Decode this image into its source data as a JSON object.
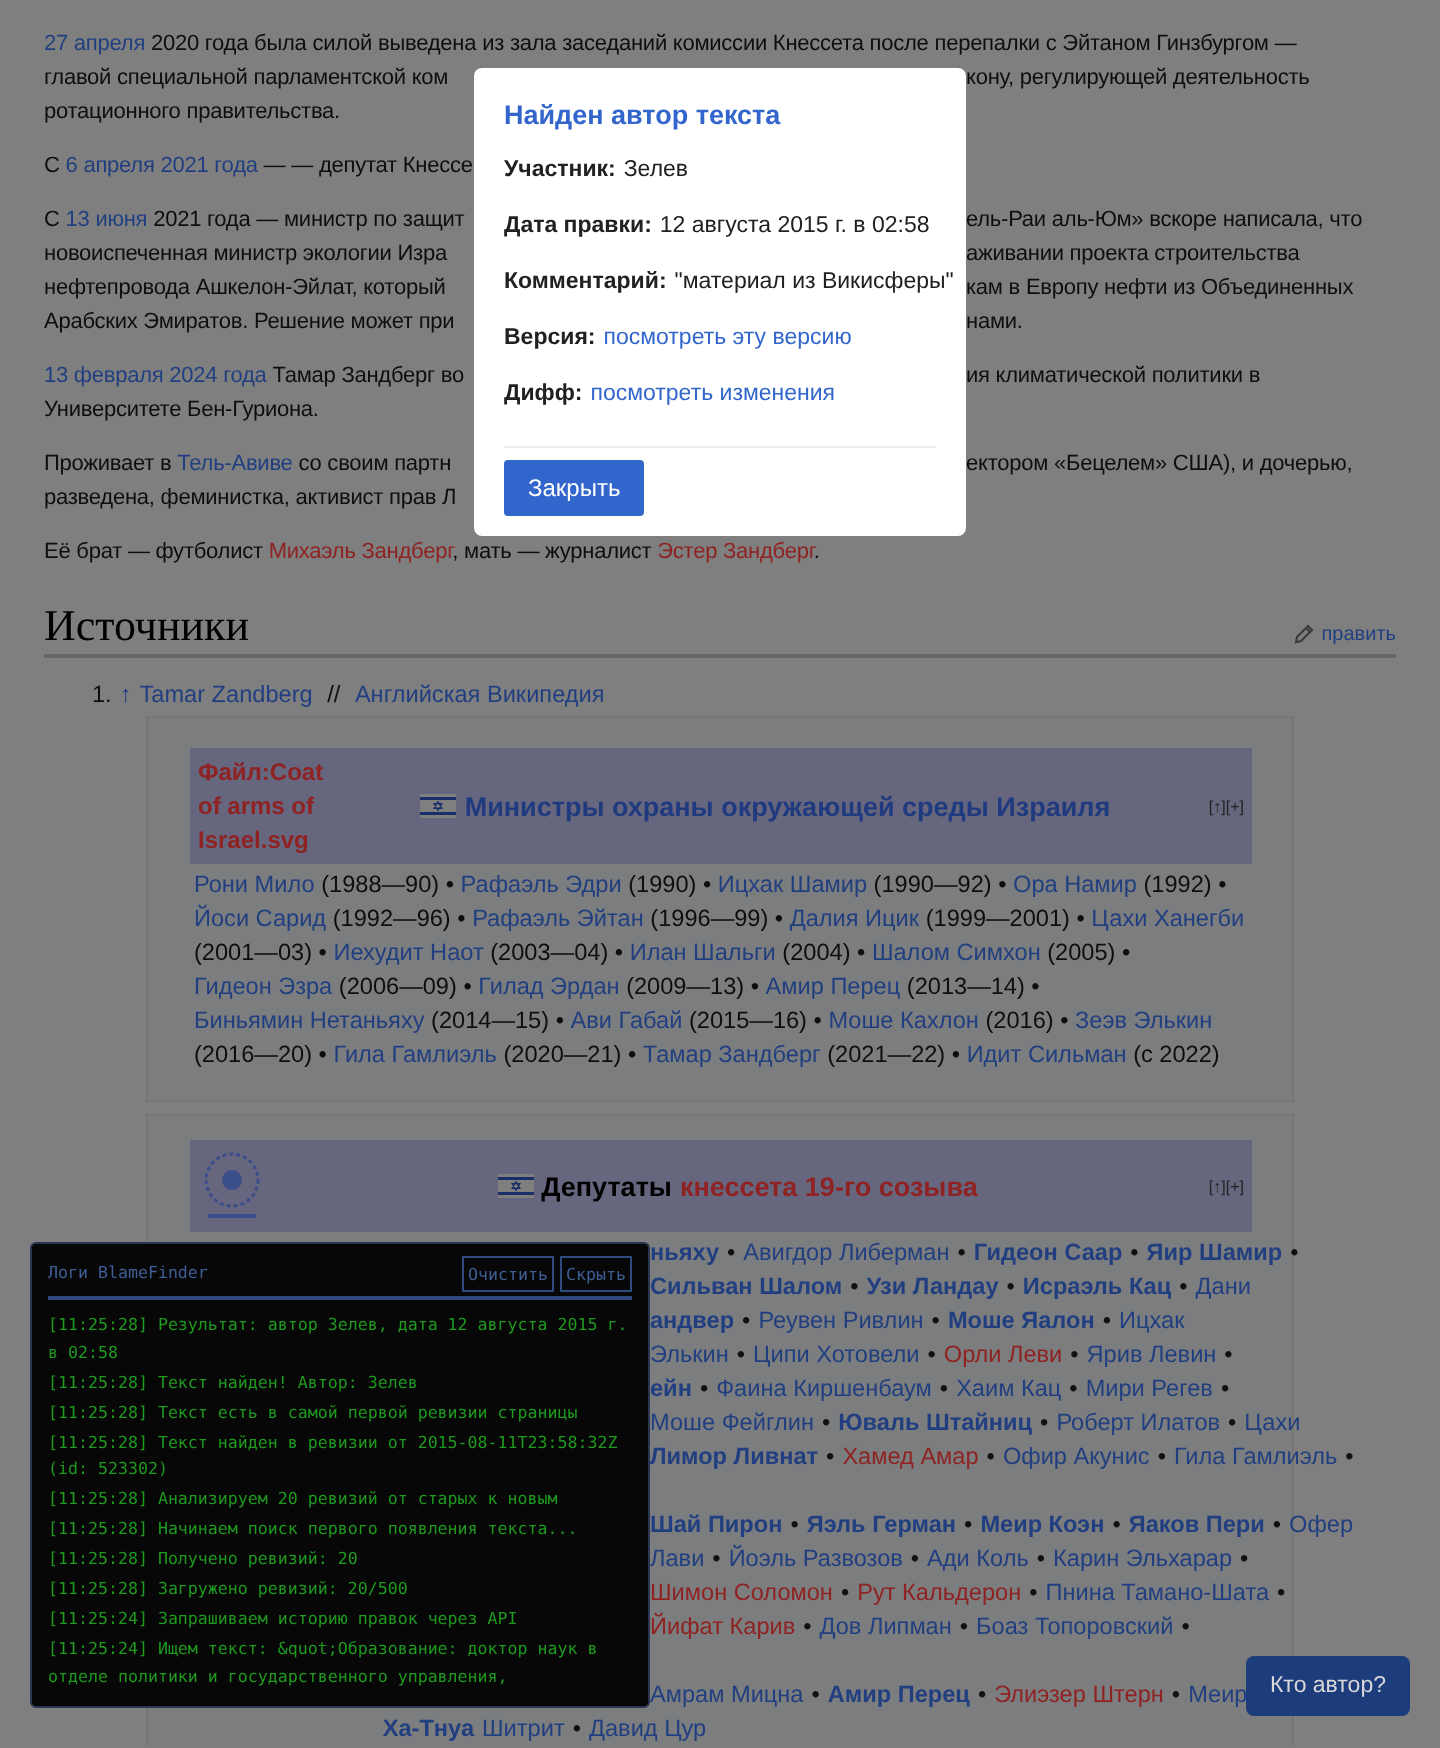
{
  "article": {
    "paragraphs": [
      {
        "lines": [
          {
            "left": [
              {
                "text": "27 апреля",
                "kind": "link"
              },
              {
                "text": " 2020 года была силой выведена из зала заседаний комиссии Кнессета после перепалки с Эйтаном Гинзбургом —",
                "kind": "text"
              }
            ]
          },
          {
            "left": [
              {
                "text": "главой специальной парламентской ком",
                "kind": "text"
              }
            ],
            "right": [
              {
                "text": "кону, регулирующей деятельность",
                "kind": "text"
              }
            ]
          },
          {
            "left": [
              {
                "text": "ротационного правительства.",
                "kind": "text"
              }
            ]
          }
        ]
      },
      {
        "lines": [
          {
            "left": [
              {
                "text": "С ",
                "kind": "text"
              },
              {
                "text": "6 апреля 2021 года",
                "kind": "link"
              },
              {
                "text": " — — депутат Кнессе",
                "kind": "text"
              }
            ]
          }
        ]
      },
      {
        "lines": [
          {
            "left": [
              {
                "text": "С ",
                "kind": "text"
              },
              {
                "text": "13 июня",
                "kind": "link"
              },
              {
                "text": " 2021 года — министр по защит",
                "kind": "text"
              }
            ],
            "right": [
              {
                "text": "ель-Раи аль-Юм» вскоре написала, что",
                "kind": "text"
              }
            ]
          },
          {
            "left": [
              {
                "text": "новоиспеченная министр экологии Изра",
                "kind": "text"
              }
            ],
            "right": [
              {
                "text": "аживании проекта строительства",
                "kind": "text"
              }
            ]
          },
          {
            "left": [
              {
                "text": "нефтепровода Ашкелон-Эйлат, который",
                "kind": "text"
              }
            ],
            "right": [
              {
                "text": "кам в Европу нефти из Объединенных",
                "kind": "text"
              }
            ]
          },
          {
            "left": [
              {
                "text": "Арабских Эмиратов. Решение может при",
                "kind": "text"
              }
            ],
            "right": [
              {
                "text": "нами.",
                "kind": "text"
              }
            ]
          }
        ]
      },
      {
        "lines": [
          {
            "left": [
              {
                "text": "13 февраля 2024 года",
                "kind": "link"
              },
              {
                "text": " Тамар Зандберг во",
                "kind": "text"
              }
            ],
            "right": [
              {
                "text": "ия климатической политики в",
                "kind": "text"
              }
            ]
          },
          {
            "left": [
              {
                "text": "Университете Бен-Гуриона.",
                "kind": "text"
              }
            ]
          }
        ]
      },
      {
        "lines": [
          {
            "left": [
              {
                "text": "Проживает в ",
                "kind": "text"
              },
              {
                "text": "Тель-Авиве",
                "kind": "link"
              },
              {
                "text": " со своим партн",
                "kind": "text"
              }
            ],
            "right": [
              {
                "text": "ектором «Бецелем» США), и дочерью,",
                "kind": "text"
              }
            ]
          },
          {
            "left": [
              {
                "text": "разведена, феминистка, активист прав Л",
                "kind": "text"
              }
            ]
          }
        ]
      },
      {
        "lines": [
          {
            "left": [
              {
                "text": "Её брат — футболист ",
                "kind": "text"
              },
              {
                "text": "Михаэль Зандберг",
                "kind": "redlink"
              },
              {
                "text": ", мать — журналист ",
                "kind": "text"
              },
              {
                "text": "Эстер Зандберг",
                "kind": "redlink"
              },
              {
                "text": ".",
                "kind": "text"
              }
            ]
          }
        ]
      }
    ]
  },
  "sources": {
    "heading": "Источники",
    "edit_link": "править",
    "references": [
      {
        "number": "1.",
        "backlink": "↑",
        "parts": [
          {
            "text": "Tamar Zandberg",
            "kind": "link"
          },
          {
            "text": " // ",
            "kind": "text"
          },
          {
            "text": "Английская Википедия",
            "kind": "link"
          }
        ]
      }
    ]
  },
  "navbox_ministers": {
    "image_link": "Файл:Coat of arms of Israel.svg",
    "title": "Министры охраны окружающей среды Израиля",
    "controls": [
      "[↑]",
      "[+]"
    ],
    "items": [
      {
        "name": "Рони Мило",
        "years": "(1988—90) •"
      },
      {
        "name": "Рафаэль Эдри",
        "years": "(1990) •"
      },
      {
        "name": "Ицхак Шамир",
        "years": "(1990—92) •"
      },
      {
        "name": "Ора Намир",
        "years": "(1992) •"
      },
      {
        "name": "Йоси Сарид",
        "years": "(1992—96) •"
      },
      {
        "name": "Рафаэль Эйтан",
        "years": "(1996—99) •"
      },
      {
        "name": "Далия Ицик",
        "years": "(1999—2001) •"
      },
      {
        "name": "Цахи Ханегби",
        "years": "(2001—03) •"
      },
      {
        "name": "Иехудит Наот",
        "years": "(2003—04) •"
      },
      {
        "name": "Илан Шальги",
        "years": "(2004) •"
      },
      {
        "name": "Шалом Симхон",
        "years": "(2005) •"
      },
      {
        "name": "Гидеон Эзра",
        "years": "(2006—09) •"
      },
      {
        "name": "Гилад Эрдан",
        "years": "(2009—13) •"
      },
      {
        "name": "Амир Перец",
        "years": "(2013—14) •"
      },
      {
        "name": "Биньямин Нетаньяху",
        "years": "(2014—15) •"
      },
      {
        "name": "Ави Габай",
        "years": "(2015—16) •"
      },
      {
        "name": "Моше Кахлон",
        "years": "(2016) •"
      },
      {
        "name": "Зеэв Элькин",
        "years": "(2016—20) •"
      },
      {
        "name": "Гила Гамлиэль",
        "years": "(2020—21) •"
      },
      {
        "name": "Тамар Зандберг",
        "years": "(2021—22) •"
      },
      {
        "name": "Идит Сильман",
        "years": "(с 2022)"
      }
    ]
  },
  "navbox_deputies": {
    "title": "Депутаты",
    "title_link": "кнессета 19-го созыва",
    "controls": [
      "[↑]",
      "[+]"
    ],
    "groups": [
      {
        "lines": [
          [
            {
              "text": "ньяху",
              "kind": "bold",
              "sep": "•"
            },
            {
              "text": "Авигдор Либерман",
              "kind": "link",
              "sep": "•"
            },
            {
              "text": "Гидеон Саар",
              "kind": "bold",
              "sep": "•"
            },
            {
              "text": "Яир Шамир",
              "kind": "bold",
              "sep": "•"
            }
          ],
          [
            {
              "text": "Сильван Шалом",
              "kind": "bold",
              "sep": "•"
            },
            {
              "text": "Узи Ландау",
              "kind": "bold",
              "sep": "•"
            },
            {
              "text": "Исраэль Кац",
              "kind": "bold",
              "sep": "•"
            },
            {
              "text": "Дани",
              "kind": "link"
            }
          ],
          [
            {
              "text": "андвер",
              "kind": "bold",
              "sep": "•"
            },
            {
              "text": "Реувен Ривлин",
              "kind": "link",
              "sep": "•"
            },
            {
              "text": "Моше Яалон",
              "kind": "bold",
              "sep": "•"
            },
            {
              "text": "Ицхак",
              "kind": "link"
            }
          ],
          [
            {
              "text": "Элькин",
              "kind": "link",
              "sep": "•"
            },
            {
              "text": "Ципи Хотовели",
              "kind": "link",
              "sep": "•"
            },
            {
              "text": "Орли Леви",
              "kind": "redlink",
              "sep": "•"
            },
            {
              "text": "Ярив Левин",
              "kind": "link",
              "sep": "•"
            }
          ],
          [
            {
              "text": "ейн",
              "kind": "bold",
              "sep": "•"
            },
            {
              "text": "Фаина Киршенбаум",
              "kind": "link",
              "sep": "•"
            },
            {
              "text": "Хаим Кац",
              "kind": "link",
              "sep": "•"
            },
            {
              "text": "Мири Регев",
              "kind": "link",
              "sep": "•"
            }
          ],
          [
            {
              "text": "Моше Фейглин",
              "kind": "link",
              "sep": "•"
            },
            {
              "text": "Юваль Штайниц",
              "kind": "bold",
              "sep": "•"
            },
            {
              "text": "Роберт Илатов",
              "kind": "link",
              "sep": "•"
            },
            {
              "text": "Цахи",
              "kind": "link"
            }
          ],
          [
            {
              "text": "Лимор Ливнат",
              "kind": "bold",
              "sep": "•"
            },
            {
              "text": "Хамед Амар",
              "kind": "redlink",
              "sep": "•"
            },
            {
              "text": "Офир Акунис",
              "kind": "link",
              "sep": "•"
            },
            {
              "text": "Гила Гамлиэль",
              "kind": "link",
              "sep": "•"
            }
          ]
        ]
      },
      {
        "lines": [
          [
            {
              "text": "Шай Пирон",
              "kind": "bold",
              "sep": "•"
            },
            {
              "text": "Яэль Герман",
              "kind": "bold",
              "sep": "•"
            },
            {
              "text": "Меир Коэн",
              "kind": "bold",
              "sep": "•"
            },
            {
              "text": "Яаков Пери",
              "kind": "bold",
              "sep": "•"
            },
            {
              "text": "Офер",
              "kind": "link"
            }
          ],
          [
            {
              "text": "Лави",
              "kind": "link",
              "sep": "•"
            },
            {
              "text": "Йоэль Развозов",
              "kind": "link",
              "sep": "•"
            },
            {
              "text": "Ади Коль",
              "kind": "link",
              "sep": "•"
            },
            {
              "text": "Карин Эльхарар",
              "kind": "link",
              "sep": "•"
            }
          ],
          [
            {
              "text": "Шимон Соломон",
              "kind": "redlink",
              "sep": "•"
            },
            {
              "text": "Рут Кальдерон",
              "kind": "redlink",
              "sep": "•"
            },
            {
              "text": "Пнина Тамано-Шата",
              "kind": "link",
              "sep": "•"
            }
          ],
          [
            {
              "text": "Йифат Карив",
              "kind": "redlink",
              "sep": "•"
            },
            {
              "text": "Дов Липман",
              "kind": "link",
              "sep": "•"
            },
            {
              "text": "Боаз Топоровский",
              "kind": "link",
              "sep": "•"
            }
          ]
        ]
      },
      {
        "label": "Ха-Тнуа",
        "lines": [
          [
            {
              "text": "Амрам Мицна",
              "kind": "link",
              "sep": "•"
            },
            {
              "text": "Амир Перец",
              "kind": "bold",
              "sep": "•"
            },
            {
              "text": "Элиэзер Штерн",
              "kind": "redlink",
              "sep": "•"
            },
            {
              "text": "Меир",
              "kind": "link"
            }
          ],
          [
            {
              "text": "Шитрит",
              "kind": "link",
              "sep": "•"
            },
            {
              "text": "Давид Цур",
              "kind": "link"
            }
          ]
        ]
      }
    ]
  },
  "author_dialog": {
    "title": "Найден автор текста",
    "rows": [
      {
        "label": "Участник:",
        "value": "Зелев",
        "kind": "text"
      },
      {
        "label": "Дата правки:",
        "value": "12 августа 2015 г. в 02:58",
        "kind": "text"
      },
      {
        "label": "Комментарий:",
        "value": "\"материал из Викисферы\"",
        "kind": "text"
      },
      {
        "label": "Версия:",
        "value": "посмотреть эту версию",
        "kind": "link"
      },
      {
        "label": "Дифф:",
        "value": "посмотреть изменения",
        "kind": "link"
      }
    ],
    "close_button": "Закрыть"
  },
  "log_panel": {
    "title": "Логи BlameFinder",
    "buttons": [
      "Очистить",
      "Скрыть"
    ],
    "entries": [
      "[11:25:28] Результат: автор Зелев, дата 12 августа 2015 г. в 02:58",
      "[11:25:28] Текст найден! Автор: Зелев",
      "[11:25:28] Текст есть в самой первой ревизии страницы",
      "[11:25:28] Текст найден в ревизии от 2015-08-11T23:58:32Z (id: 523302)",
      "[11:25:28] Анализируем 20 ревизий от старых к новым",
      "[11:25:28] Начинаем поиск первого появления текста...",
      "[11:25:28] Получено ревизий: 20",
      "[11:25:28] Загружено ревизий: 20/500",
      "[11:25:24] Запрашиваем историю правок через API",
      "[11:25:24] Ищем текст: &quot;Образование: доктор наук в отделе политики и государственного управления,"
    ]
  },
  "who_button": "Кто автор?"
}
